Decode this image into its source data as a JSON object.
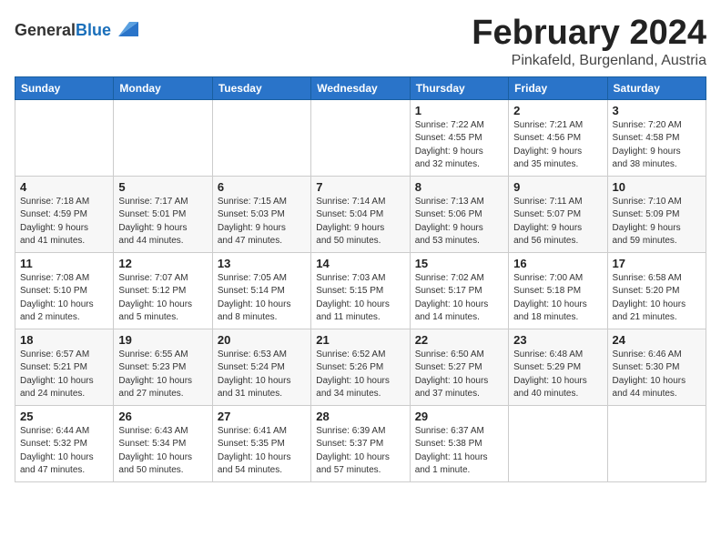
{
  "header": {
    "logo_general": "General",
    "logo_blue": "Blue",
    "month_title": "February 2024",
    "location": "Pinkafeld, Burgenland, Austria"
  },
  "days_of_week": [
    "Sunday",
    "Monday",
    "Tuesday",
    "Wednesday",
    "Thursday",
    "Friday",
    "Saturday"
  ],
  "weeks": [
    [
      {
        "day": "",
        "info": ""
      },
      {
        "day": "",
        "info": ""
      },
      {
        "day": "",
        "info": ""
      },
      {
        "day": "",
        "info": ""
      },
      {
        "day": "1",
        "info": "Sunrise: 7:22 AM\nSunset: 4:55 PM\nDaylight: 9 hours\nand 32 minutes."
      },
      {
        "day": "2",
        "info": "Sunrise: 7:21 AM\nSunset: 4:56 PM\nDaylight: 9 hours\nand 35 minutes."
      },
      {
        "day": "3",
        "info": "Sunrise: 7:20 AM\nSunset: 4:58 PM\nDaylight: 9 hours\nand 38 minutes."
      }
    ],
    [
      {
        "day": "4",
        "info": "Sunrise: 7:18 AM\nSunset: 4:59 PM\nDaylight: 9 hours\nand 41 minutes."
      },
      {
        "day": "5",
        "info": "Sunrise: 7:17 AM\nSunset: 5:01 PM\nDaylight: 9 hours\nand 44 minutes."
      },
      {
        "day": "6",
        "info": "Sunrise: 7:15 AM\nSunset: 5:03 PM\nDaylight: 9 hours\nand 47 minutes."
      },
      {
        "day": "7",
        "info": "Sunrise: 7:14 AM\nSunset: 5:04 PM\nDaylight: 9 hours\nand 50 minutes."
      },
      {
        "day": "8",
        "info": "Sunrise: 7:13 AM\nSunset: 5:06 PM\nDaylight: 9 hours\nand 53 minutes."
      },
      {
        "day": "9",
        "info": "Sunrise: 7:11 AM\nSunset: 5:07 PM\nDaylight: 9 hours\nand 56 minutes."
      },
      {
        "day": "10",
        "info": "Sunrise: 7:10 AM\nSunset: 5:09 PM\nDaylight: 9 hours\nand 59 minutes."
      }
    ],
    [
      {
        "day": "11",
        "info": "Sunrise: 7:08 AM\nSunset: 5:10 PM\nDaylight: 10 hours\nand 2 minutes."
      },
      {
        "day": "12",
        "info": "Sunrise: 7:07 AM\nSunset: 5:12 PM\nDaylight: 10 hours\nand 5 minutes."
      },
      {
        "day": "13",
        "info": "Sunrise: 7:05 AM\nSunset: 5:14 PM\nDaylight: 10 hours\nand 8 minutes."
      },
      {
        "day": "14",
        "info": "Sunrise: 7:03 AM\nSunset: 5:15 PM\nDaylight: 10 hours\nand 11 minutes."
      },
      {
        "day": "15",
        "info": "Sunrise: 7:02 AM\nSunset: 5:17 PM\nDaylight: 10 hours\nand 14 minutes."
      },
      {
        "day": "16",
        "info": "Sunrise: 7:00 AM\nSunset: 5:18 PM\nDaylight: 10 hours\nand 18 minutes."
      },
      {
        "day": "17",
        "info": "Sunrise: 6:58 AM\nSunset: 5:20 PM\nDaylight: 10 hours\nand 21 minutes."
      }
    ],
    [
      {
        "day": "18",
        "info": "Sunrise: 6:57 AM\nSunset: 5:21 PM\nDaylight: 10 hours\nand 24 minutes."
      },
      {
        "day": "19",
        "info": "Sunrise: 6:55 AM\nSunset: 5:23 PM\nDaylight: 10 hours\nand 27 minutes."
      },
      {
        "day": "20",
        "info": "Sunrise: 6:53 AM\nSunset: 5:24 PM\nDaylight: 10 hours\nand 31 minutes."
      },
      {
        "day": "21",
        "info": "Sunrise: 6:52 AM\nSunset: 5:26 PM\nDaylight: 10 hours\nand 34 minutes."
      },
      {
        "day": "22",
        "info": "Sunrise: 6:50 AM\nSunset: 5:27 PM\nDaylight: 10 hours\nand 37 minutes."
      },
      {
        "day": "23",
        "info": "Sunrise: 6:48 AM\nSunset: 5:29 PM\nDaylight: 10 hours\nand 40 minutes."
      },
      {
        "day": "24",
        "info": "Sunrise: 6:46 AM\nSunset: 5:30 PM\nDaylight: 10 hours\nand 44 minutes."
      }
    ],
    [
      {
        "day": "25",
        "info": "Sunrise: 6:44 AM\nSunset: 5:32 PM\nDaylight: 10 hours\nand 47 minutes."
      },
      {
        "day": "26",
        "info": "Sunrise: 6:43 AM\nSunset: 5:34 PM\nDaylight: 10 hours\nand 50 minutes."
      },
      {
        "day": "27",
        "info": "Sunrise: 6:41 AM\nSunset: 5:35 PM\nDaylight: 10 hours\nand 54 minutes."
      },
      {
        "day": "28",
        "info": "Sunrise: 6:39 AM\nSunset: 5:37 PM\nDaylight: 10 hours\nand 57 minutes."
      },
      {
        "day": "29",
        "info": "Sunrise: 6:37 AM\nSunset: 5:38 PM\nDaylight: 11 hours\nand 1 minute."
      },
      {
        "day": "",
        "info": ""
      },
      {
        "day": "",
        "info": ""
      }
    ]
  ]
}
